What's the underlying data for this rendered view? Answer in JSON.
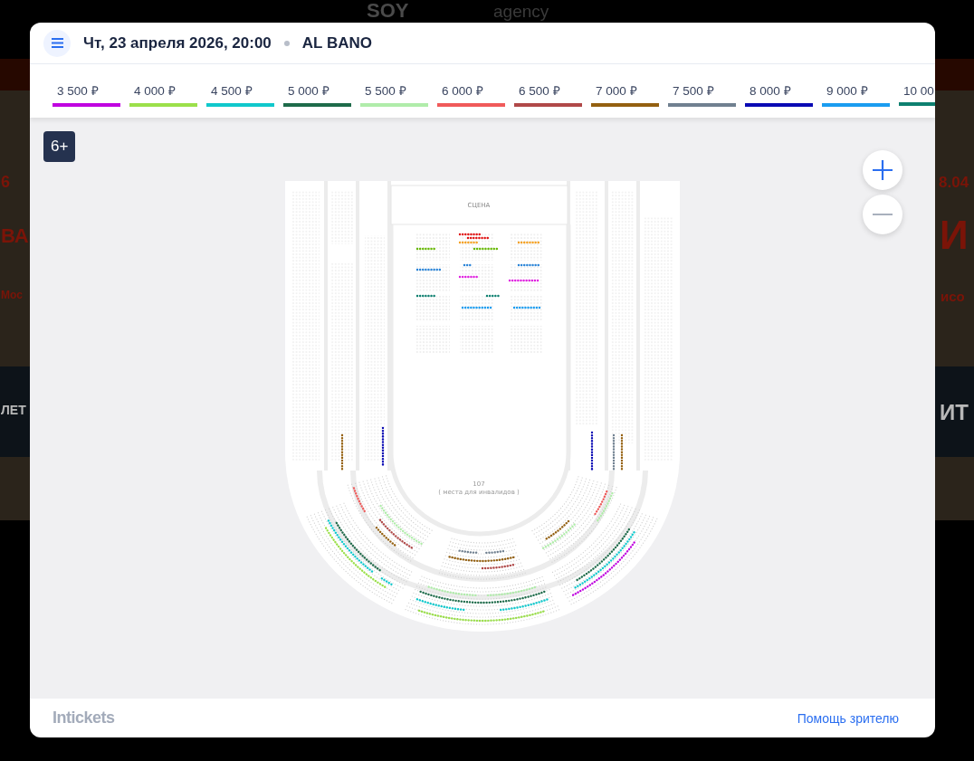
{
  "backdrop": {
    "logo": [
      "SOY",
      "agency"
    ],
    "left_texts": [
      "6",
      "ВА",
      "Мос",
      "ЛЕТ"
    ],
    "right_texts": [
      "8.04",
      "И",
      "исо",
      "ИТ"
    ]
  },
  "header": {
    "date": "Чт, 23 апреля 2026, 20:00",
    "event": "AL BANO"
  },
  "prices": [
    {
      "label": "3 500 ₽",
      "color": "#c000e0"
    },
    {
      "label": "4 000 ₽",
      "color": "#9be04a"
    },
    {
      "label": "4 500 ₽",
      "color": "#10c8cc"
    },
    {
      "label": "5 000 ₽",
      "color": "#1e6b4a"
    },
    {
      "label": "5 500 ₽",
      "color": "#b0ecaa"
    },
    {
      "label": "6 000 ₽",
      "color": "#f05a5a"
    },
    {
      "label": "6 500 ₽",
      "color": "#b04848"
    },
    {
      "label": "7 000 ₽",
      "color": "#946010"
    },
    {
      "label": "7 500 ₽",
      "color": "#708090"
    },
    {
      "label": "8 000 ₽",
      "color": "#0a0ab4"
    },
    {
      "label": "9 000 ₽",
      "color": "#1a9cf0"
    },
    {
      "label": "10 00",
      "color": "#0e8070"
    }
  ],
  "age_badge": "6+",
  "seat_map": {
    "stage": "СЦЕНА",
    "sector": "107",
    "sector_note": "( места для инвалидов )"
  },
  "footer": {
    "logo": "Intickets",
    "help_link": "Помощь зрителю"
  }
}
